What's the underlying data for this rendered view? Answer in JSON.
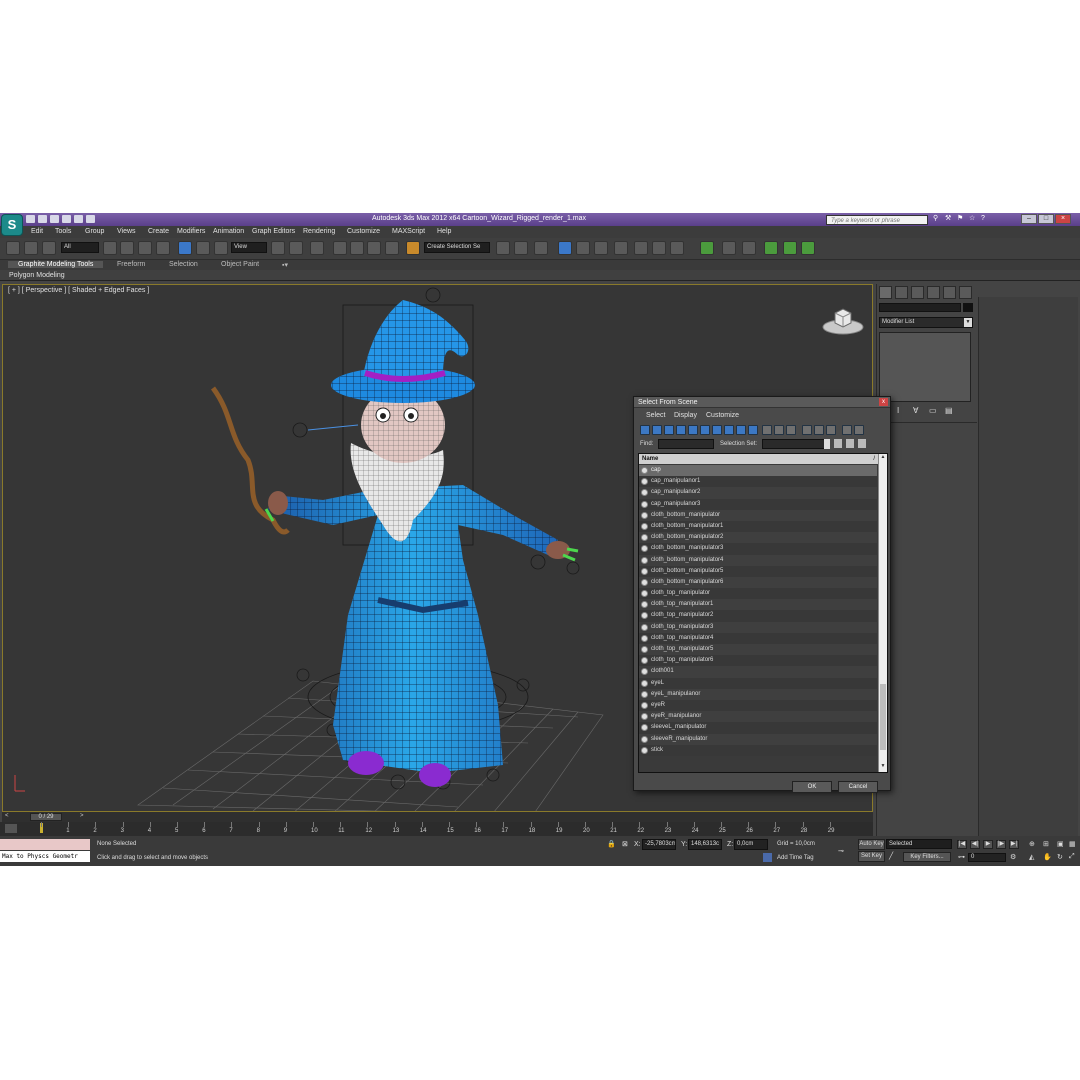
{
  "window": {
    "app_logo": "S",
    "title": "Autodesk 3ds Max  2012 x64      Cartoon_Wizard_Rigged_render_1.max",
    "search_placeholder": "Type a keyword or phrase"
  },
  "menu": [
    "Edit",
    "Tools",
    "Group",
    "Views",
    "Create",
    "Modifiers",
    "Animation",
    "Graph Editors",
    "Rendering",
    "Customize",
    "MAXScript",
    "Help"
  ],
  "toolbar": {
    "filter_value": "All",
    "ref_coord_value": "View",
    "named_selection_value": "Create Selection Se"
  },
  "ribbon": {
    "tabs": [
      "Graphite Modeling Tools",
      "Freeform",
      "Selection",
      "Object Paint"
    ],
    "panel": "Polygon Modeling"
  },
  "viewport": {
    "label": "[ + ] [ Perspective ] [ Shaded + Edged Faces ]"
  },
  "command_panel": {
    "modifier_list": "Modifier List"
  },
  "dialog": {
    "title": "Select From Scene",
    "close": "x",
    "menu": [
      "Select",
      "Display",
      "Customize"
    ],
    "find_label": "Find:",
    "selection_set_label": "Selection Set:",
    "column_name": "Name",
    "sort_indicator": "/",
    "items": [
      "cap",
      "cap_manipulanor1",
      "cap_manipulanor2",
      "cap_manipulanor3",
      "cloth_bottom_manipulator",
      "cloth_bottom_manipulator1",
      "cloth_bottom_manipulator2",
      "cloth_bottom_manipulator3",
      "cloth_bottom_manipulator4",
      "cloth_bottom_manipulator5",
      "cloth_bottom_manipulator6",
      "cloth_top_manipulator",
      "cloth_top_manipulator1",
      "cloth_top_manipulator2",
      "cloth_top_manipulator3",
      "cloth_top_manipulator4",
      "cloth_top_manipulator5",
      "cloth_top_manipulator6",
      "cloth001",
      "eyeL",
      "eyeL_manipulanor",
      "eyeR",
      "eyeR_manipulanor",
      "sleeveL_manipulator",
      "sleeveR_manipulator",
      "stick"
    ],
    "ok": "OK",
    "cancel": "Cancel"
  },
  "timeline": {
    "frame_indicator": "0 / 29",
    "prev": "<",
    "next": ">",
    "ticks": [
      "0",
      "1",
      "2",
      "3",
      "4",
      "5",
      "6",
      "7",
      "8",
      "9",
      "10",
      "11",
      "12",
      "13",
      "14",
      "15",
      "16",
      "17",
      "18",
      "19",
      "20",
      "21",
      "22",
      "23",
      "24",
      "25",
      "26",
      "27",
      "28",
      "29"
    ]
  },
  "status": {
    "maxscript_line": "Max to Physcs Geometr",
    "selection": "None Selected",
    "prompt": "Click and drag to select and move objects",
    "x_label": "X:",
    "x_value": "-25,7803cm",
    "y_label": "Y:",
    "y_value": "148,6313c",
    "z_label": "Z:",
    "z_value": "0,0cm",
    "grid": "Grid = 10,0cm",
    "add_time_tag": "Add Time Tag",
    "auto_key": "Auto Key",
    "set_key": "Set Key",
    "selected_dropdown": "Selected",
    "key_filters": "Key Filters...",
    "current_frame": "0"
  }
}
